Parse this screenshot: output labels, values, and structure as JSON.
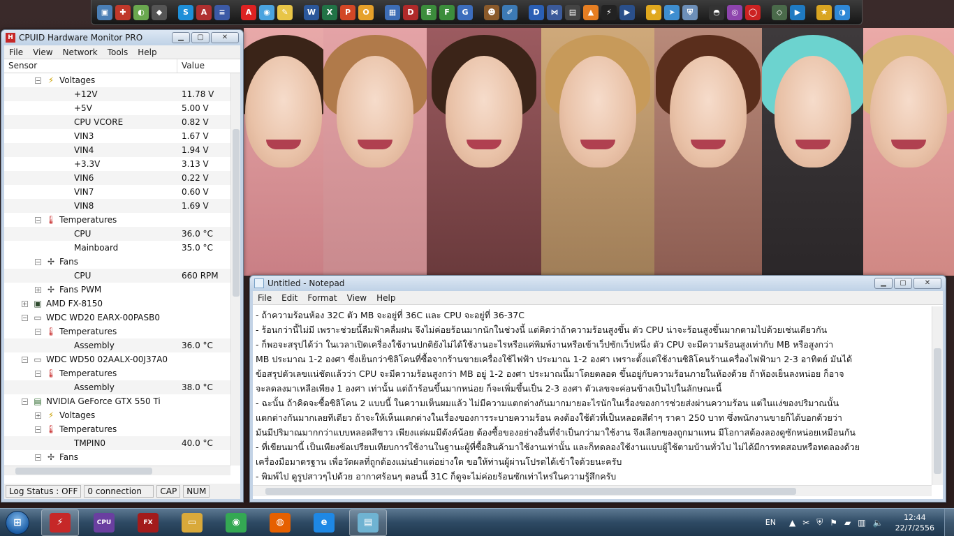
{
  "hwmonitor": {
    "title": "CPUID Hardware Monitor PRO",
    "menu": [
      "File",
      "View",
      "Network",
      "Tools",
      "Help"
    ],
    "columns": {
      "sensor": "Sensor",
      "value": "Value"
    },
    "tree": [
      {
        "type": "group",
        "depth": 2,
        "label": "Voltages",
        "icon": "voltage-icon"
      },
      {
        "type": "leaf",
        "depth": 3,
        "label": "+12V",
        "value": "11.78 V",
        "shade": true
      },
      {
        "type": "leaf",
        "depth": 3,
        "label": "+5V",
        "value": "5.00 V"
      },
      {
        "type": "leaf",
        "depth": 3,
        "label": "CPU VCORE",
        "value": "0.82 V",
        "shade": true
      },
      {
        "type": "leaf",
        "depth": 3,
        "label": "VIN3",
        "value": "1.67 V"
      },
      {
        "type": "leaf",
        "depth": 3,
        "label": "VIN4",
        "value": "1.94 V",
        "shade": true
      },
      {
        "type": "leaf",
        "depth": 3,
        "label": "+3.3V",
        "value": "3.13 V"
      },
      {
        "type": "leaf",
        "depth": 3,
        "label": "VIN6",
        "value": "0.22 V",
        "shade": true
      },
      {
        "type": "leaf",
        "depth": 3,
        "label": "VIN7",
        "value": "0.60 V"
      },
      {
        "type": "leaf",
        "depth": 3,
        "label": "VIN8",
        "value": "1.69 V",
        "shade": true
      },
      {
        "type": "group",
        "depth": 2,
        "label": "Temperatures",
        "icon": "thermometer-icon"
      },
      {
        "type": "leaf",
        "depth": 3,
        "label": "CPU",
        "value": "36.0 °C",
        "shade": true
      },
      {
        "type": "leaf",
        "depth": 3,
        "label": "Mainboard",
        "value": "35.0 °C"
      },
      {
        "type": "group",
        "depth": 2,
        "label": "Fans",
        "icon": "fan-icon"
      },
      {
        "type": "leaf",
        "depth": 3,
        "label": "CPU",
        "value": "660 RPM",
        "shade": true
      },
      {
        "type": "group",
        "depth": 2,
        "label": "Fans PWM",
        "icon": "fan-icon",
        "collapsed": true
      },
      {
        "type": "group",
        "depth": 1,
        "label": "AMD FX-8150",
        "icon": "cpu-chip-icon",
        "collapsed": true
      },
      {
        "type": "group",
        "depth": 1,
        "label": "WDC WD20 EARX-00PASB0",
        "icon": "hard-drive-icon"
      },
      {
        "type": "group",
        "depth": 2,
        "label": "Temperatures",
        "icon": "thermometer-icon"
      },
      {
        "type": "leaf",
        "depth": 3,
        "label": "Assembly",
        "value": "36.0 °C",
        "shade": true
      },
      {
        "type": "group",
        "depth": 1,
        "label": "WDC WD50 02AALX-00J37A0",
        "icon": "hard-drive-icon"
      },
      {
        "type": "group",
        "depth": 2,
        "label": "Temperatures",
        "icon": "thermometer-icon"
      },
      {
        "type": "leaf",
        "depth": 3,
        "label": "Assembly",
        "value": "38.0 °C",
        "shade": true
      },
      {
        "type": "group",
        "depth": 1,
        "label": "NVIDIA GeForce GTX 550 Ti",
        "icon": "gpu-icon"
      },
      {
        "type": "group",
        "depth": 2,
        "label": "Voltages",
        "icon": "voltage-icon",
        "collapsed": true
      },
      {
        "type": "group",
        "depth": 2,
        "label": "Temperatures",
        "icon": "thermometer-icon"
      },
      {
        "type": "leaf",
        "depth": 3,
        "label": "TMPIN0",
        "value": "40.0 °C",
        "shade": true
      },
      {
        "type": "group",
        "depth": 2,
        "label": "Fans",
        "icon": "fan-icon"
      }
    ],
    "status": {
      "log": "Log Status : OFF",
      "connection": "0 connection",
      "cap": "CAP",
      "num": "NUM"
    }
  },
  "notepad": {
    "title": "Untitled - Notepad",
    "menu": [
      "File",
      "Edit",
      "Format",
      "View",
      "Help"
    ],
    "lines": [
      "- ถ้าความร้อนห้อง 32C   ตัว MB    จะอยู่ที่ 36C  และ CPU   จะอยู่ที่ 36-37C",
      "- ร้อนกว่านี้ไม่มี เพราะช่วยนี้ลืมฟ้าคลื่มฝน จึงไม่ค่อยร้อนมากนักในช่วงนี้ แต่คิดว่าถ้าความร้อนสูงขึ้น ตัว CPU   น่าจะร้อนสูงขึ้นมากตามไปด้วยเช่นเดียวกัน",
      "- ก็พอจะสรุปได้ว่า ในเวลาเปิดเครื่องใช้งานปกติยังไม่ได้ใช้งานอะไรหรือแค่พิมพ์งานหรือเข้าเว็ปซักเว็ปหนึ่ง ตัว CPU   จะมีความร้อนสูงเท่ากับ MB   หรือสูงกว่า",
      "MB   ประมาณ 1-2 องศา ซึ่งเย็นกว่าซิลิโคนที่ซื้อจากร้านขายเครื่องใช้ไฟฟ้า ประมาณ 1-2 องศา เพราะตั้งแต่ใช้งานซิลิโคนร้านเครื่องไฟฟ้ามา 2-3 อาทิตย์ มันได้",
      "ข้อสรุปตัวเลขแน่ชัดแล้วว่า CPU   จะมีความร้อนสูงกว่า MB   อยู่ 1-2 องศา ประมาณนี้มาโดยตลอด ขึ้นอยู่กับความร้อนภายในห้องด้วย ถ้าห้องเย็นลงหน่อย ก็อาจ",
      "จะลดลงมาเหลือเพียง 1 องศา เท่านั้น แต่ถ้าร้อนขึ้นมากหน่อย ก็จะเพิ่มขึ้นเป็น 2-3 องศา ตัวเลขจะค่อนข้างเป็นไปในลักษณะนี้",
      "- ฉะนั้น ถ้าคิดจะซื้อซิลิโคน 2 แบบนี้ ในความเห็นผมแล้ว ไม่มีความแตกต่างกันมากมายอะไรนักในเรื่องของการช่วยส่งผ่านความร้อน แต่ในแง่ของปริมาณนั้น",
      "แตกต่างกันมากเลยทีเดียว ถ้าจะให้เห็นแตกต่างในเรื่องของการระบายความร้อน คงต้องใช้ตัวที่เป็นหลอดสีดำๆ ราคา 250 บาท ซึ่งพนักงานขายก็ได้บอกด้วยว่า",
      "มันมีปริมาณมากกว่าแบบหลอดสีขาว เพียงแต่ผมมีตังค์น้อย ต้องซื้อของอย่างอื่นที่จำเป็นกว่ามาใช้งาน จึงเลือกของถูกมาแทน มีโอกาสต้องลองดูซักหน่อยเหมือนกัน",
      "- ที่เขียนมานี้ เป็นเพียงข้อเปรียบเทียบการใช้งานในฐานะผู้ที่ซื้อสินค้ามาใช้งานเท่านั้น และก็ทดลองใช้งานแบบผู้ใช้ตามบ้านทั่วไป ไม่ได้มีการทดสอบหรือทดลองด้วย",
      "เครื่องมือมาตรฐาน เพื่อวัดผลที่ถูกต้องแม่นยำแต่อย่างใด ขอให้ท่านผู้ผ่านโปรดได้เข้าใจด้วยนะครับ",
      "- พิมพ์ไป ดูรูปสาวๆไปด้วย อากาศร้อนๆ ตอนนี้ 31C   ก็ดูจะไม่ค่อยร้อนซักเท่าไหร่ในความรู้สึกครับ"
    ]
  },
  "dock": {
    "icons": [
      {
        "name": "computer-icon",
        "glyph": "▣",
        "color": "#4a7fb5"
      },
      {
        "name": "toolbox-icon",
        "glyph": "✚",
        "color": "#c0392b"
      },
      {
        "name": "picture-icon",
        "glyph": "◐",
        "color": "#6aa84f"
      },
      {
        "name": "linux-penguin-icon",
        "glyph": "◆",
        "color": "#555555"
      },
      {
        "name": "sep",
        "glyph": "",
        "color": ""
      },
      {
        "name": "skype-icon",
        "glyph": "S",
        "color": "#1e8fd8"
      },
      {
        "name": "dictionary-icon",
        "glyph": "A",
        "color": "#b03030"
      },
      {
        "name": "flag-icon",
        "glyph": "≡",
        "color": "#3c5aa6"
      },
      {
        "name": "sep",
        "glyph": "",
        "color": ""
      },
      {
        "name": "pdf-icon",
        "glyph": "A",
        "color": "#d22"
      },
      {
        "name": "photo-viewer-icon",
        "glyph": "◉",
        "color": "#4aa3df"
      },
      {
        "name": "notes-icon",
        "glyph": "✎",
        "color": "#e8c547"
      },
      {
        "name": "sep",
        "glyph": "",
        "color": ""
      },
      {
        "name": "word-icon",
        "glyph": "W",
        "color": "#2b579a"
      },
      {
        "name": "excel-icon",
        "glyph": "X",
        "color": "#217346"
      },
      {
        "name": "powerpoint-icon",
        "glyph": "P",
        "color": "#d24726"
      },
      {
        "name": "office-icon",
        "glyph": "O",
        "color": "#e6a12a"
      },
      {
        "name": "sep",
        "glyph": "",
        "color": ""
      },
      {
        "name": "control-panel-icon",
        "glyph": "▦",
        "color": "#3d6db5"
      },
      {
        "name": "drive-d-icon",
        "glyph": "D",
        "color": "#b02a2a"
      },
      {
        "name": "drive-e-icon",
        "glyph": "E",
        "color": "#3c8d3c"
      },
      {
        "name": "drive-f-icon",
        "glyph": "F",
        "color": "#3c8d3c"
      },
      {
        "name": "drive-g-icon",
        "glyph": "G",
        "color": "#3c6dbd"
      },
      {
        "name": "sep",
        "glyph": "",
        "color": ""
      },
      {
        "name": "character-icon",
        "glyph": "☻",
        "color": "#8a5a2b"
      },
      {
        "name": "paint-icon",
        "glyph": "✐",
        "color": "#3c7ab5"
      },
      {
        "name": "sep",
        "glyph": "",
        "color": ""
      },
      {
        "name": "daemon-tools-icon",
        "glyph": "D",
        "color": "#2a5fb5"
      },
      {
        "name": "bowtie-icon",
        "glyph": "⋈",
        "color": "#3b5a9a"
      },
      {
        "name": "film-icon",
        "glyph": "▤",
        "color": "#444444"
      },
      {
        "name": "vlc-icon",
        "glyph": "▲",
        "color": "#e67e22"
      },
      {
        "name": "lightning-icon",
        "glyph": "⚡",
        "color": "#222222"
      },
      {
        "name": "media-player-icon",
        "glyph": "▶",
        "color": "#2a4f8a"
      },
      {
        "name": "sep",
        "glyph": "",
        "color": ""
      },
      {
        "name": "sun-icon",
        "glyph": "✹",
        "color": "#e0a81e"
      },
      {
        "name": "bird-icon",
        "glyph": "➤",
        "color": "#3e8ed0"
      },
      {
        "name": "shield-icon",
        "glyph": "⛨",
        "color": "#6d8fb8"
      },
      {
        "name": "sep",
        "glyph": "",
        "color": ""
      },
      {
        "name": "sunglasses-icon",
        "glyph": "◓",
        "color": "#333333"
      },
      {
        "name": "disc-icon",
        "glyph": "◎",
        "color": "#8e44ad"
      },
      {
        "name": "opera-icon",
        "glyph": "◯",
        "color": "#cc2222"
      },
      {
        "name": "sep",
        "glyph": "",
        "color": ""
      },
      {
        "name": "slides-icon",
        "glyph": "◇",
        "color": "#4a6a4a"
      },
      {
        "name": "play-icon",
        "glyph": "▶",
        "color": "#1f7ac2"
      },
      {
        "name": "sep",
        "glyph": "",
        "color": ""
      },
      {
        "name": "star-icon",
        "glyph": "★",
        "color": "#d9a521"
      },
      {
        "name": "globe-icon",
        "glyph": "◑",
        "color": "#2f88d6"
      }
    ]
  },
  "taskbar": {
    "start_glyph": "⊞",
    "apps": [
      {
        "name": "hwmonitor-taskbar-icon",
        "glyph": "⚡",
        "color": "#c62828",
        "active": true
      },
      {
        "name": "cpuz-taskbar-icon",
        "glyph": "CPU",
        "color": "#6a3fa0",
        "active": false
      },
      {
        "name": "amd-fx-taskbar-icon",
        "glyph": "FX",
        "color": "#a31b1b",
        "active": false
      },
      {
        "name": "file-explorer-taskbar-icon",
        "glyph": "▭",
        "color": "#d9a93a",
        "active": false
      },
      {
        "name": "chrome-taskbar-icon",
        "glyph": "◉",
        "color": "#34a853",
        "active": false
      },
      {
        "name": "firefox-taskbar-icon",
        "glyph": "◍",
        "color": "#e66000",
        "active": false
      },
      {
        "name": "internet-explorer-taskbar-icon",
        "glyph": "e",
        "color": "#1e88e5",
        "active": false
      },
      {
        "name": "notepad-taskbar-icon",
        "glyph": "▤",
        "color": "#6fb3d2",
        "active": true
      }
    ],
    "tray": {
      "language": "EN",
      "icons": [
        {
          "name": "tray-expand-icon",
          "glyph": "▲"
        },
        {
          "name": "tray-tools-icon",
          "glyph": "✂"
        },
        {
          "name": "tray-shield-icon",
          "glyph": "⛨"
        },
        {
          "name": "action-center-flag-icon",
          "glyph": "⚑"
        },
        {
          "name": "tray-monitor-icon",
          "glyph": "▰"
        },
        {
          "name": "network-icon",
          "glyph": "▥"
        },
        {
          "name": "volume-icon",
          "glyph": "🔈"
        }
      ],
      "time": "12:44",
      "date": "22/7/2556"
    }
  }
}
